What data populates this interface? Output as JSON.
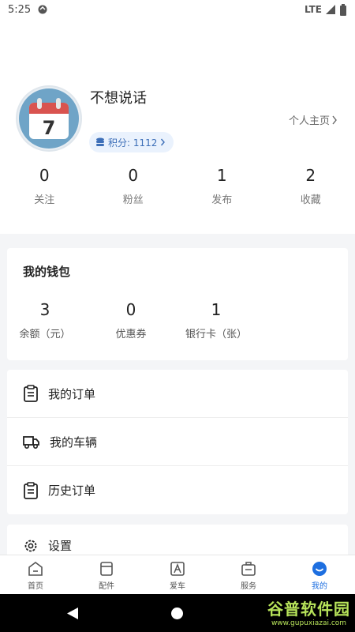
{
  "status_bar": {
    "time": "5:25",
    "network": "LTE"
  },
  "profile": {
    "username": "不想说话",
    "points_label": "积分: 1112",
    "homepage_link": "个人主页",
    "avatar_day": "7"
  },
  "stats": [
    {
      "value": "0",
      "label": "关注"
    },
    {
      "value": "0",
      "label": "粉丝"
    },
    {
      "value": "1",
      "label": "发布"
    },
    {
      "value": "2",
      "label": "收藏"
    }
  ],
  "wallet": {
    "title": "我的钱包",
    "items": [
      {
        "value": "3",
        "label": "余额（元）"
      },
      {
        "value": "0",
        "label": "优惠券"
      },
      {
        "value": "1",
        "label": "银行卡（张）"
      }
    ]
  },
  "menu": [
    {
      "label": "我的订单",
      "icon": "clipboard-icon"
    },
    {
      "label": "我的车辆",
      "icon": "truck-icon"
    },
    {
      "label": "历史订单",
      "icon": "clipboard-icon"
    }
  ],
  "settings": {
    "label": "设置",
    "icon": "gear-icon"
  },
  "tabbar": [
    {
      "label": "首页",
      "icon": "home-icon"
    },
    {
      "label": "配件",
      "icon": "parts-icon"
    },
    {
      "label": "爱车",
      "icon": "car-icon"
    },
    {
      "label": "服务",
      "icon": "briefcase-icon"
    },
    {
      "label": "我的",
      "icon": "profile-face-icon",
      "active": true
    }
  ],
  "watermark": {
    "title": "谷普软件园",
    "url": "www.gupuxiazai.com"
  },
  "colors": {
    "accent": "#1e6fe0",
    "background": "#f4f5f7",
    "points_badge": "#eaf2fd"
  }
}
